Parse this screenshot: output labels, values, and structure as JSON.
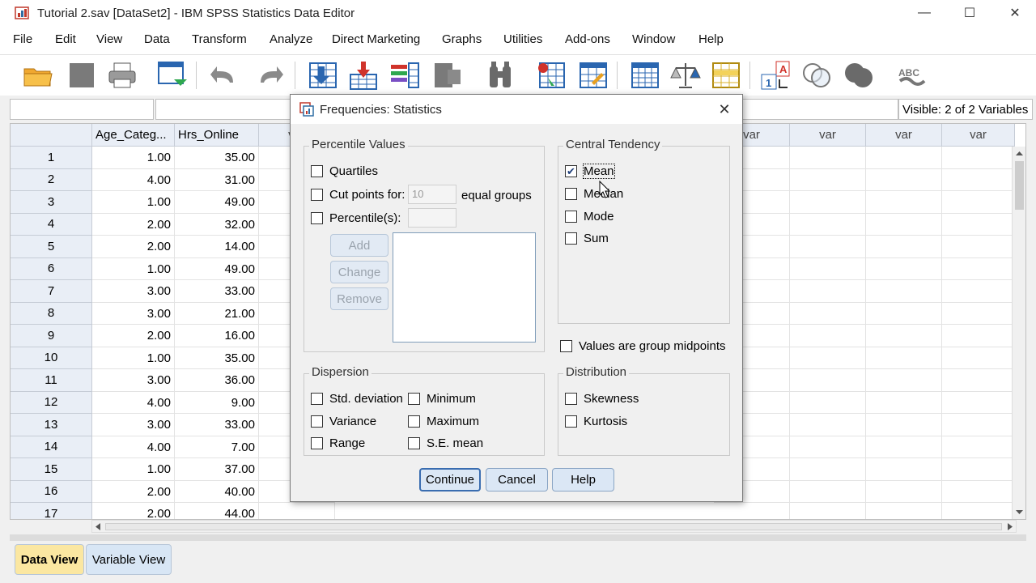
{
  "window": {
    "title": "Tutorial 2.sav [DataSet2] - IBM SPSS Statistics Data Editor",
    "minimize_glyph": "—",
    "maximize_glyph": "☐",
    "close_glyph": "✕"
  },
  "menu": {
    "items": [
      "File",
      "Edit",
      "View",
      "Data",
      "Transform",
      "Analyze",
      "Direct Marketing",
      "Graphs",
      "Utilities",
      "Add-ons",
      "Window",
      "Help"
    ]
  },
  "toolbar": {
    "icons": [
      "open-folder-icon",
      "save-icon",
      "print-icon",
      "dialog-recall-icon",
      "undo-icon",
      "redo-icon",
      "goto-case-icon",
      "goto-variable-icon",
      "variables-icon",
      "run-descriptives-icon",
      "find-icon",
      "insert-cases-icon",
      "insert-variable-icon",
      "split-file-icon",
      "weight-cases-icon",
      "select-cases-icon",
      "value-labels-icon",
      "use-variable-sets-icon",
      "show-all-variables-icon",
      "spell-check-icon"
    ]
  },
  "editor": {
    "cell_reference": "",
    "cell_value": "",
    "visible_variables": "Visible: 2 of 2 Variables"
  },
  "grid": {
    "columns": [
      "Age_Categ...",
      "Hrs_Online"
    ],
    "empty_column_label": "var",
    "rows": [
      {
        "n": "1",
        "age": "1.00",
        "hrs": "35.00"
      },
      {
        "n": "2",
        "age": "4.00",
        "hrs": "31.00"
      },
      {
        "n": "3",
        "age": "1.00",
        "hrs": "49.00"
      },
      {
        "n": "4",
        "age": "2.00",
        "hrs": "32.00"
      },
      {
        "n": "5",
        "age": "2.00",
        "hrs": "14.00"
      },
      {
        "n": "6",
        "age": "1.00",
        "hrs": "49.00"
      },
      {
        "n": "7",
        "age": "3.00",
        "hrs": "33.00"
      },
      {
        "n": "8",
        "age": "3.00",
        "hrs": "21.00"
      },
      {
        "n": "9",
        "age": "2.00",
        "hrs": "16.00"
      },
      {
        "n": "10",
        "age": "1.00",
        "hrs": "35.00"
      },
      {
        "n": "11",
        "age": "3.00",
        "hrs": "36.00"
      },
      {
        "n": "12",
        "age": "4.00",
        "hrs": "9.00"
      },
      {
        "n": "13",
        "age": "3.00",
        "hrs": "33.00"
      },
      {
        "n": "14",
        "age": "4.00",
        "hrs": "7.00"
      },
      {
        "n": "15",
        "age": "1.00",
        "hrs": "37.00"
      },
      {
        "n": "16",
        "age": "2.00",
        "hrs": "40.00"
      },
      {
        "n": "17",
        "age": "2.00",
        "hrs": "44.00"
      }
    ]
  },
  "tabs": {
    "data_view": "Data View",
    "variable_view": "Variable View"
  },
  "dialog": {
    "title": "Frequencies: Statistics",
    "close_glyph": "✕",
    "percentile_values": {
      "legend": "Percentile Values",
      "quartiles": "Quartiles",
      "cut_points": "Cut points for:",
      "cut_points_value": "10",
      "equal_groups": "equal groups",
      "percentiles": "Percentile(s):",
      "add": "Add",
      "change": "Change",
      "remove": "Remove"
    },
    "central_tendency": {
      "legend": "Central Tendency",
      "mean": "Mean",
      "median": "Median",
      "mode": "Mode",
      "sum": "Sum",
      "mean_checked": true,
      "check_glyph": "✔"
    },
    "values_group_midpoints": "Values are group midpoints",
    "dispersion": {
      "legend": "Dispersion",
      "std_deviation": "Std. deviation",
      "minimum": "Minimum",
      "variance": "Variance",
      "maximum": "Maximum",
      "range": "Range",
      "se_mean": "S.E. mean"
    },
    "distribution": {
      "legend": "Distribution",
      "skewness": "Skewness",
      "kurtosis": "Kurtosis"
    },
    "buttons": {
      "continue": "Continue",
      "cancel": "Cancel",
      "help": "Help"
    }
  }
}
